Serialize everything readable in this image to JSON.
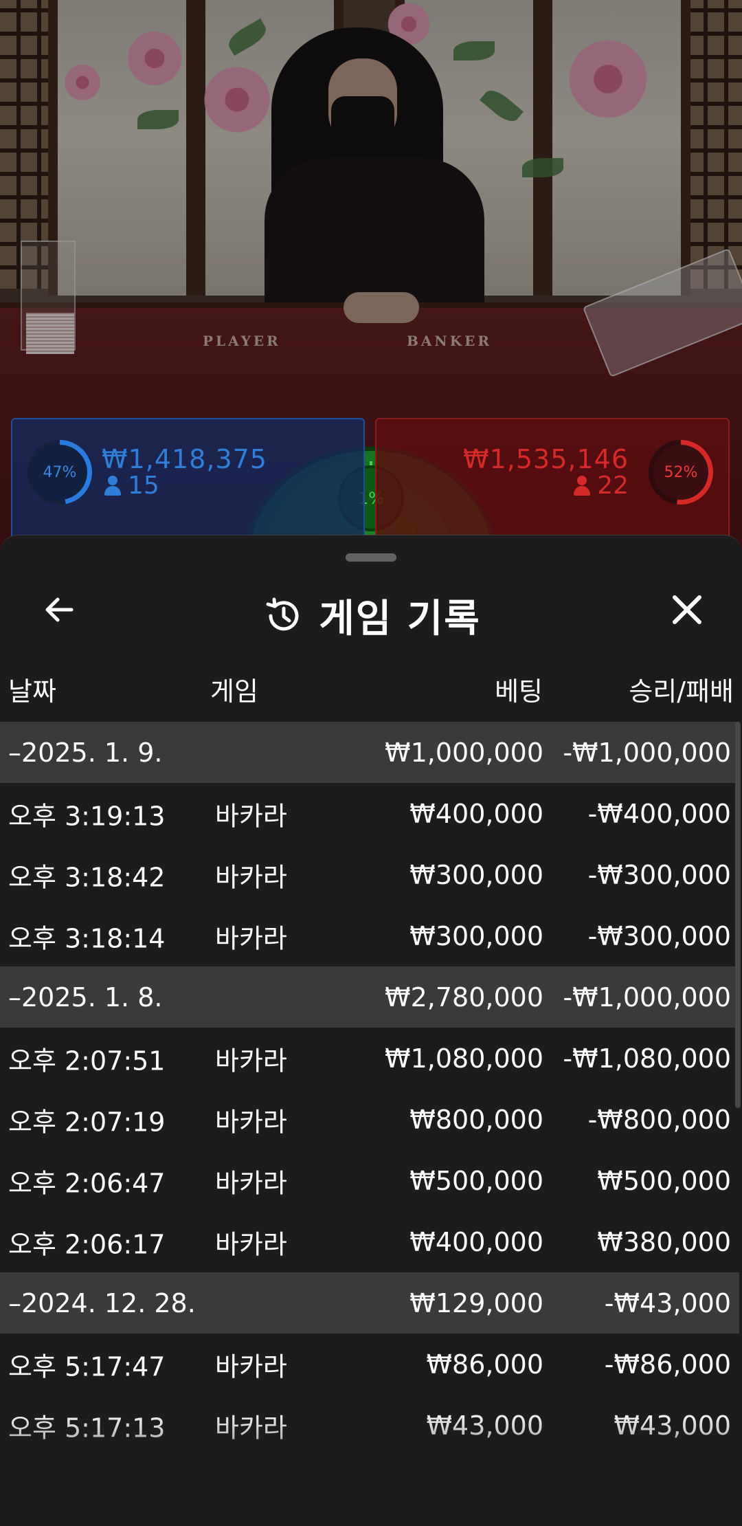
{
  "video": {
    "felt_labels": [
      "PLAYER",
      "BANKER"
    ]
  },
  "bets": {
    "player": {
      "percent": "47%",
      "amount": "₩1,418,375",
      "count": "15",
      "color": "#2f7ed8"
    },
    "tie": {
      "percent": "1%",
      "color": "#47d052"
    },
    "banker": {
      "percent": "52%",
      "amount": "₩1,535,146",
      "count": "22",
      "color": "#d42a2a"
    }
  },
  "sheet": {
    "title": "게임 기록",
    "title_icon": "history-icon",
    "back_icon": "arrow-left-icon",
    "close_icon": "close-icon",
    "columns": {
      "date": "날짜",
      "game": "게임",
      "bet": "베팅",
      "result": "승리/패배"
    },
    "rows": [
      {
        "type": "date",
        "date": "–2025. 1. 9.",
        "bet": "₩1,000,000",
        "result": "-₩1,000,000"
      },
      {
        "type": "entry",
        "date": "오후 3:19:13",
        "game": "바카라",
        "bet": "₩400,000",
        "result": "-₩400,000"
      },
      {
        "type": "entry",
        "date": "오후 3:18:42",
        "game": "바카라",
        "bet": "₩300,000",
        "result": "-₩300,000"
      },
      {
        "type": "entry",
        "date": "오후 3:18:14",
        "game": "바카라",
        "bet": "₩300,000",
        "result": "-₩300,000"
      },
      {
        "type": "date",
        "date": "–2025. 1. 8.",
        "bet": "₩2,780,000",
        "result": "-₩1,000,000"
      },
      {
        "type": "entry",
        "date": "오후 2:07:51",
        "game": "바카라",
        "bet": "₩1,080,000",
        "result": "-₩1,080,000"
      },
      {
        "type": "entry",
        "date": "오후 2:07:19",
        "game": "바카라",
        "bet": "₩800,000",
        "result": "-₩800,000"
      },
      {
        "type": "entry",
        "date": "오후 2:06:47",
        "game": "바카라",
        "bet": "₩500,000",
        "result": "₩500,000"
      },
      {
        "type": "entry",
        "date": "오후 2:06:17",
        "game": "바카라",
        "bet": "₩400,000",
        "result": "₩380,000"
      },
      {
        "type": "date",
        "date": "–2024. 12. 28.",
        "bet": "₩129,000",
        "result": "-₩43,000"
      },
      {
        "type": "entry",
        "date": "오후 5:17:47",
        "game": "바카라",
        "bet": "₩86,000",
        "result": "-₩86,000"
      },
      {
        "type": "entry",
        "date": "오후 5:17:13",
        "game": "바카라",
        "bet": "₩43,000",
        "result": "₩43,000"
      }
    ]
  }
}
